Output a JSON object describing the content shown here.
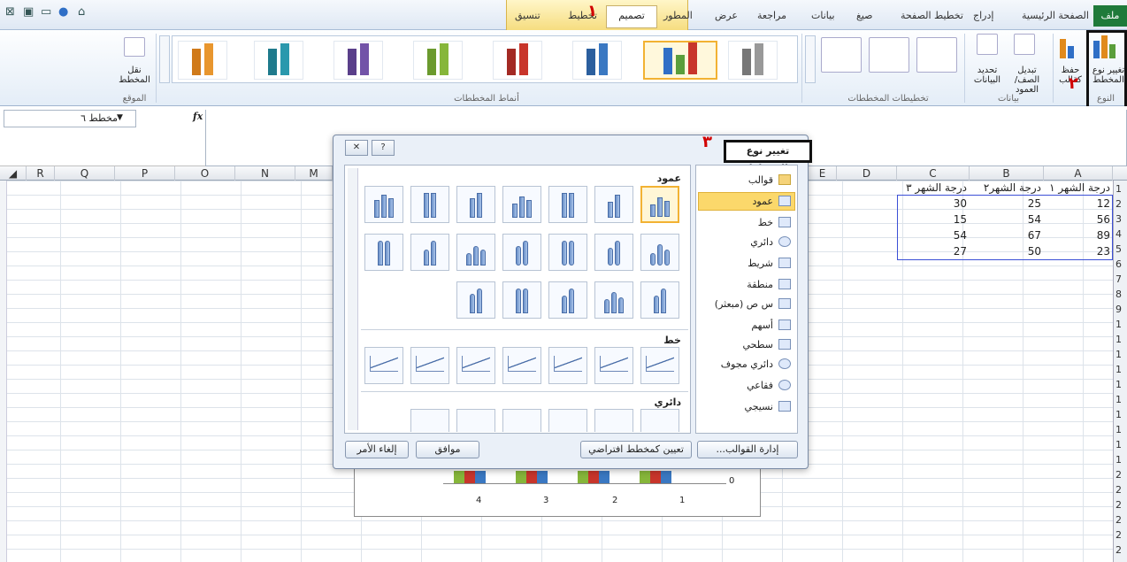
{
  "ribbon_tabs": {
    "file": "ملف",
    "home": "الصفحة الرئيسية",
    "insert": "إدراج",
    "page_layout": "تخطيط الصفحة",
    "formulas": "صيغ",
    "data": "بيانات",
    "review": "مراجعة",
    "view": "عرض",
    "developer": "المطور",
    "design": "تصميم",
    "layout": "تخطيط",
    "format": "تنسيق"
  },
  "annotations": {
    "n1": "١",
    "n2": "٢",
    "n3": "٣"
  },
  "ribbon": {
    "type_group": {
      "label": "النوع",
      "change_type": "تغيير نوع المخطط",
      "save_template": "حفظ كقالب"
    },
    "data_group": {
      "label": "بيانات",
      "switch": "تبديل الصف/العمود",
      "select": "تحديد البيانات"
    },
    "layouts_group": {
      "label": "تخطيطات المخططات"
    },
    "styles_group": {
      "label": "أنماط المخططات"
    },
    "location_group": {
      "label": "الموقع",
      "move": "نقل المخطط"
    }
  },
  "formula_bar": {
    "name_box": "مخطط ٦",
    "fx": "fx"
  },
  "columns": [
    "A",
    "B",
    "C",
    "D",
    "E",
    "M",
    "N",
    "O",
    "P",
    "Q",
    "R"
  ],
  "sheet": {
    "headers": [
      "درجة الشهر ١",
      "درجة الشهر٢",
      "درجة الشهر ٣"
    ],
    "rows": [
      [
        "12",
        "25",
        "30"
      ],
      [
        "56",
        "54",
        "15"
      ],
      [
        "89",
        "67",
        "54"
      ],
      [
        "23",
        "50",
        "27"
      ]
    ],
    "row_numbers": [
      "1",
      "2",
      "3",
      "4",
      "5",
      "6",
      "7",
      "8",
      "9",
      "1",
      "1",
      "1",
      "1",
      "1",
      "1",
      "1",
      "1",
      "1",
      "1",
      "2",
      "2",
      "2",
      "2",
      "2",
      "2"
    ]
  },
  "chart_axis": {
    "x_labels": [
      "1",
      "2",
      "3",
      "4"
    ],
    "y_label": "0"
  },
  "dialog": {
    "title": "تغيير نوع المخطط",
    "help": "?",
    "close": "✕",
    "categories": [
      "قوالب",
      "عمود",
      "خط",
      "دائري",
      "شريط",
      "منطقة",
      "س ص (مبعثر)",
      "أسهم",
      "سطحي",
      "دائري مجوف",
      "فقاعي",
      "نسيجي"
    ],
    "selected_category": "عمود",
    "sections": {
      "column": "عمود",
      "line": "خط",
      "pie": "دائري"
    },
    "manage_templates": "إدارة القوالب...",
    "set_default": "تعيين كمخطط افتراضي",
    "ok": "موافق",
    "cancel": "إلغاء الأمر"
  },
  "colors": {
    "accent_green": "#1f7a3a",
    "selection_gold": "#f2b233",
    "range_blue": "#3b4fd6"
  }
}
